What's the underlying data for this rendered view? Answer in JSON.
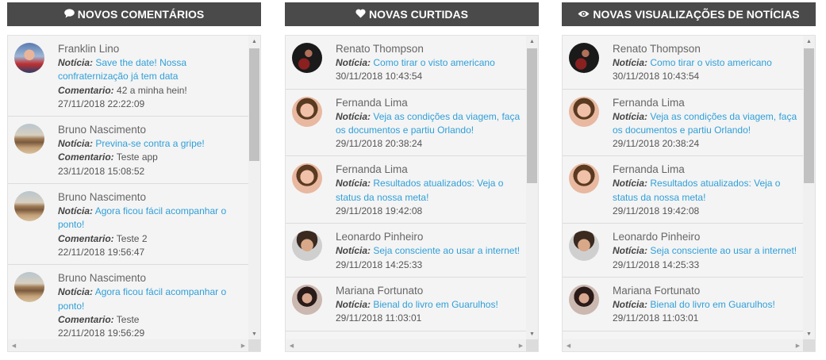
{
  "panels": [
    {
      "title": "NOVOS COMENTÁRIOS",
      "icon": "comment-icon",
      "items": [
        {
          "name": "Franklin Lino",
          "noticia_label": "Notícia:",
          "noticia": "Save the date! Nossa confraternização já tem data",
          "comentario_label": "Comentario:",
          "comentario": "42 a minha hein!",
          "date": "27/11/2018 22:22:09",
          "avatar": "franklin"
        },
        {
          "name": "Bruno Nascimento",
          "noticia_label": "Notícia:",
          "noticia": "Previna-se contra a gripe!",
          "comentario_label": "Comentario:",
          "comentario": "Teste app",
          "date": "23/11/2018 15:08:52",
          "avatar": "bruno"
        },
        {
          "name": "Bruno Nascimento",
          "noticia_label": "Notícia:",
          "noticia": "Agora ficou fácil acompanhar o ponto!",
          "comentario_label": "Comentario:",
          "comentario": "Teste 2",
          "date": "22/11/2018 19:56:47",
          "avatar": "bruno"
        },
        {
          "name": "Bruno Nascimento",
          "noticia_label": "Notícia:",
          "noticia": "Agora ficou fácil acompanhar o ponto!",
          "comentario_label": "Comentario:",
          "comentario": "Teste",
          "date": "22/11/2018 19:56:29",
          "avatar": "bruno"
        }
      ]
    },
    {
      "title": "NOVAS CURTIDAS",
      "icon": "heart-icon",
      "items": [
        {
          "name": "Renato Thompson",
          "noticia_label": "Notícia:",
          "noticia": "Como tirar o visto americano",
          "date": "30/11/2018 10:43:54",
          "avatar": "renato"
        },
        {
          "name": "Fernanda Lima",
          "noticia_label": "Notícia:",
          "noticia": "Veja as condições da viagem, faça os documentos e partiu Orlando!",
          "date": "29/11/2018 20:38:24",
          "avatar": "fernanda"
        },
        {
          "name": "Fernanda Lima",
          "noticia_label": "Notícia:",
          "noticia": "Resultados atualizados: Veja o status da nossa meta!",
          "date": "29/11/2018 19:42:08",
          "avatar": "fernanda"
        },
        {
          "name": "Leonardo Pinheiro",
          "noticia_label": "Notícia:",
          "noticia": "Seja consciente ao usar a internet!",
          "date": "29/11/2018 14:25:33",
          "avatar": "leonardo"
        },
        {
          "name": "Mariana Fortunato",
          "noticia_label": "Notícia:",
          "noticia": "Bienal do livro em Guarulhos!",
          "date": "29/11/2018 11:03:01",
          "avatar": "mariana"
        }
      ]
    },
    {
      "title": "NOVAS VISUALIZAÇÕES DE NOTÍCIAS",
      "icon": "eye-icon",
      "items": [
        {
          "name": "Renato Thompson",
          "noticia_label": "Notícia:",
          "noticia": "Como tirar o visto americano",
          "date": "30/11/2018 10:43:54",
          "avatar": "renato"
        },
        {
          "name": "Fernanda Lima",
          "noticia_label": "Notícia:",
          "noticia": "Veja as condições da viagem, faça os documentos e partiu Orlando!",
          "date": "29/11/2018 20:38:24",
          "avatar": "fernanda"
        },
        {
          "name": "Fernanda Lima",
          "noticia_label": "Notícia:",
          "noticia": "Resultados atualizados: Veja o status da nossa meta!",
          "date": "29/11/2018 19:42:08",
          "avatar": "fernanda"
        },
        {
          "name": "Leonardo Pinheiro",
          "noticia_label": "Notícia:",
          "noticia": "Seja consciente ao usar a internet!",
          "date": "29/11/2018 14:25:33",
          "avatar": "leonardo"
        },
        {
          "name": "Mariana Fortunato",
          "noticia_label": "Notícia:",
          "noticia": "Bienal do livro em Guarulhos!",
          "date": "29/11/2018 11:03:01",
          "avatar": "mariana"
        }
      ]
    }
  ],
  "colors": {
    "header_bg": "#4a4a4a",
    "link": "#2f9fd8",
    "item_bg": "#f4f4f4"
  }
}
